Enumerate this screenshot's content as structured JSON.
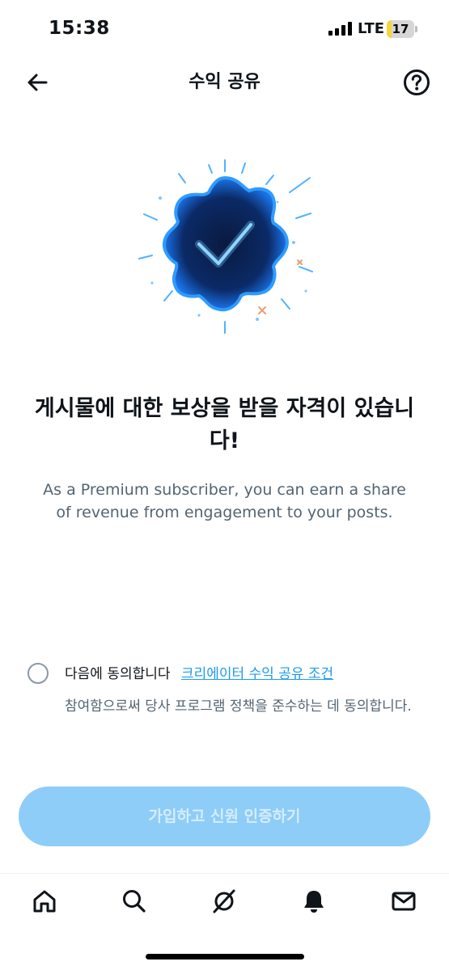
{
  "status_bar": {
    "time": "15:38",
    "network": "LTE",
    "battery": "17",
    "battery_level": 0.17
  },
  "header": {
    "title": "수익 공유",
    "back_icon": "back-arrow-icon",
    "help_icon": "help-circle-icon"
  },
  "hero": {
    "icon": "verified-badge-icon"
  },
  "headline": "게시물에 대한 보상을 받을 자격이 있습니다!",
  "subtitle": "As a Premium subscriber, you can earn a share of revenue from engagement to your posts.",
  "agreement": {
    "checked": false,
    "prefix": "다음에 동의합니다",
    "link": "크리에이터 수익 공유 조건",
    "description": "참여함으로써 당사 프로그램 정책을 준수하는 데 동의합니다."
  },
  "cta_label": "가입하고 신원 인증하기",
  "bottom_nav": [
    {
      "name": "home",
      "icon": "home-icon"
    },
    {
      "name": "search",
      "icon": "search-icon"
    },
    {
      "name": "grok",
      "icon": "slash-circle-icon"
    },
    {
      "name": "notifications",
      "icon": "bell-icon"
    },
    {
      "name": "messages",
      "icon": "mail-icon"
    }
  ],
  "colors": {
    "accent": "#1d9bf0",
    "cta_disabled": "#8ecdf8",
    "secondary_text": "#536471",
    "battery": "#f5d53a"
  }
}
